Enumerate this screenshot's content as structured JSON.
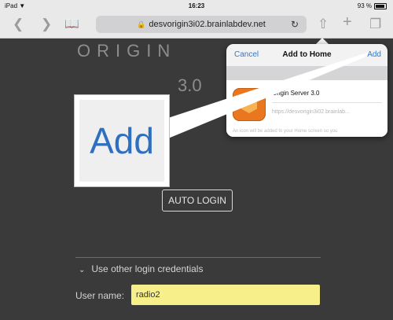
{
  "status_bar": {
    "device": "iPad",
    "wifi_icon": "wifi-icon",
    "time": "16:23",
    "battery": "93 %"
  },
  "toolbar": {
    "back_icon": "chevron-left-icon",
    "forward_icon": "chevron-right-icon",
    "bookmarks_icon": "book-icon",
    "url": "desvorigin3i02.brainlabdev.net",
    "lock_icon": "lock-icon",
    "reload_icon": "reload-icon",
    "share_icon": "share-icon",
    "new_tab_icon": "plus-icon",
    "tabs_icon": "tabs-icon"
  },
  "page": {
    "origin_title": "ORIGIN",
    "origin_version": "3.0",
    "auto_login_label": "AUTO LOGIN",
    "other_credentials_label": "Use other login credentials",
    "user_name_label": "User name:",
    "user_name_value": "radio2"
  },
  "popover": {
    "cancel_label": "Cancel",
    "title": "Add to Home",
    "add_label": "Add",
    "app_name": "Origin Server 3.0",
    "app_url": "https://desvorigin3i02.brainlab...",
    "note": "An icon will be added to your Home screen so you"
  },
  "callout": {
    "zoom_text": "Add"
  },
  "colors": {
    "accent": "#2f7ad0",
    "field_highlight": "#f6ef8a",
    "app_icon": "#e8771f"
  }
}
